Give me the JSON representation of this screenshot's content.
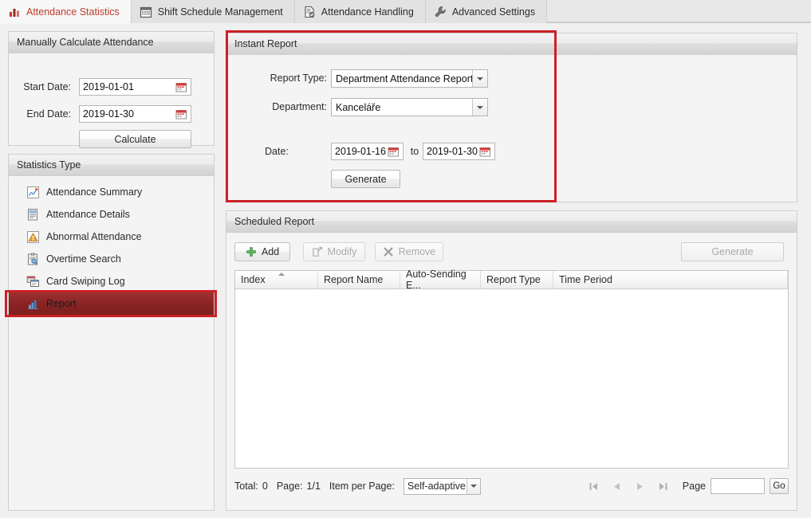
{
  "tabs": [
    {
      "label": "Attendance Statistics",
      "icon": "bar-chart-icon",
      "active": true
    },
    {
      "label": "Shift Schedule Management",
      "icon": "calendar-icon",
      "active": false
    },
    {
      "label": "Attendance Handling",
      "icon": "document-clock-icon",
      "active": false
    },
    {
      "label": "Advanced Settings",
      "icon": "wrench-icon",
      "active": false
    }
  ],
  "manual_calc": {
    "title": "Manually Calculate Attendance",
    "start_date_label": "Start Date:",
    "start_date_value": "2019-01-01",
    "end_date_label": "End Date:",
    "end_date_value": "2019-01-30",
    "calculate_label": "Calculate"
  },
  "statistics_type": {
    "title": "Statistics Type",
    "items": [
      {
        "label": "Attendance Summary",
        "icon": "chart-line-icon",
        "selected": false
      },
      {
        "label": "Attendance Details",
        "icon": "list-document-icon",
        "selected": false
      },
      {
        "label": "Abnormal Attendance",
        "icon": "warning-pyramid-icon",
        "selected": false
      },
      {
        "label": "Overtime Search",
        "icon": "clipboard-search-icon",
        "selected": false
      },
      {
        "label": "Card Swiping Log",
        "icon": "cards-icon",
        "selected": false
      },
      {
        "label": "Report",
        "icon": "report-bar-icon",
        "selected": true
      }
    ]
  },
  "instant_report": {
    "title": "Instant Report",
    "report_type_label": "Report Type:",
    "report_type_value": "Department Attendance Report",
    "department_label": "Department:",
    "department_value": "Kanceláře",
    "date_label": "Date:",
    "date_from": "2019-01-16",
    "date_to_label": "to",
    "date_to": "2019-01-30",
    "generate_label": "Generate"
  },
  "scheduled_report": {
    "title": "Scheduled Report",
    "toolbar": {
      "add_label": "Add",
      "modify_label": "Modify",
      "remove_label": "Remove",
      "generate_label": "Generate"
    },
    "columns": [
      "Index",
      "Report Name",
      "Auto-Sending E...",
      "Report Type",
      "Time Period"
    ],
    "rows": [],
    "pagination": {
      "total_label": "Total:",
      "total_value": "0",
      "page_label": "Page:",
      "page_value": "1/1",
      "item_per_page_label": "Item per Page:",
      "item_per_page_value": "Self-adaptive",
      "page_jump_label": "Page",
      "page_jump_value": "",
      "go_label": "Go"
    }
  },
  "colors": {
    "accent_red": "#cc2026",
    "active_tab_text": "#c0392b",
    "selected_row_bg": "#8a2423",
    "panel_bg": "#f4f4f4",
    "header_bg": "#dedede"
  }
}
